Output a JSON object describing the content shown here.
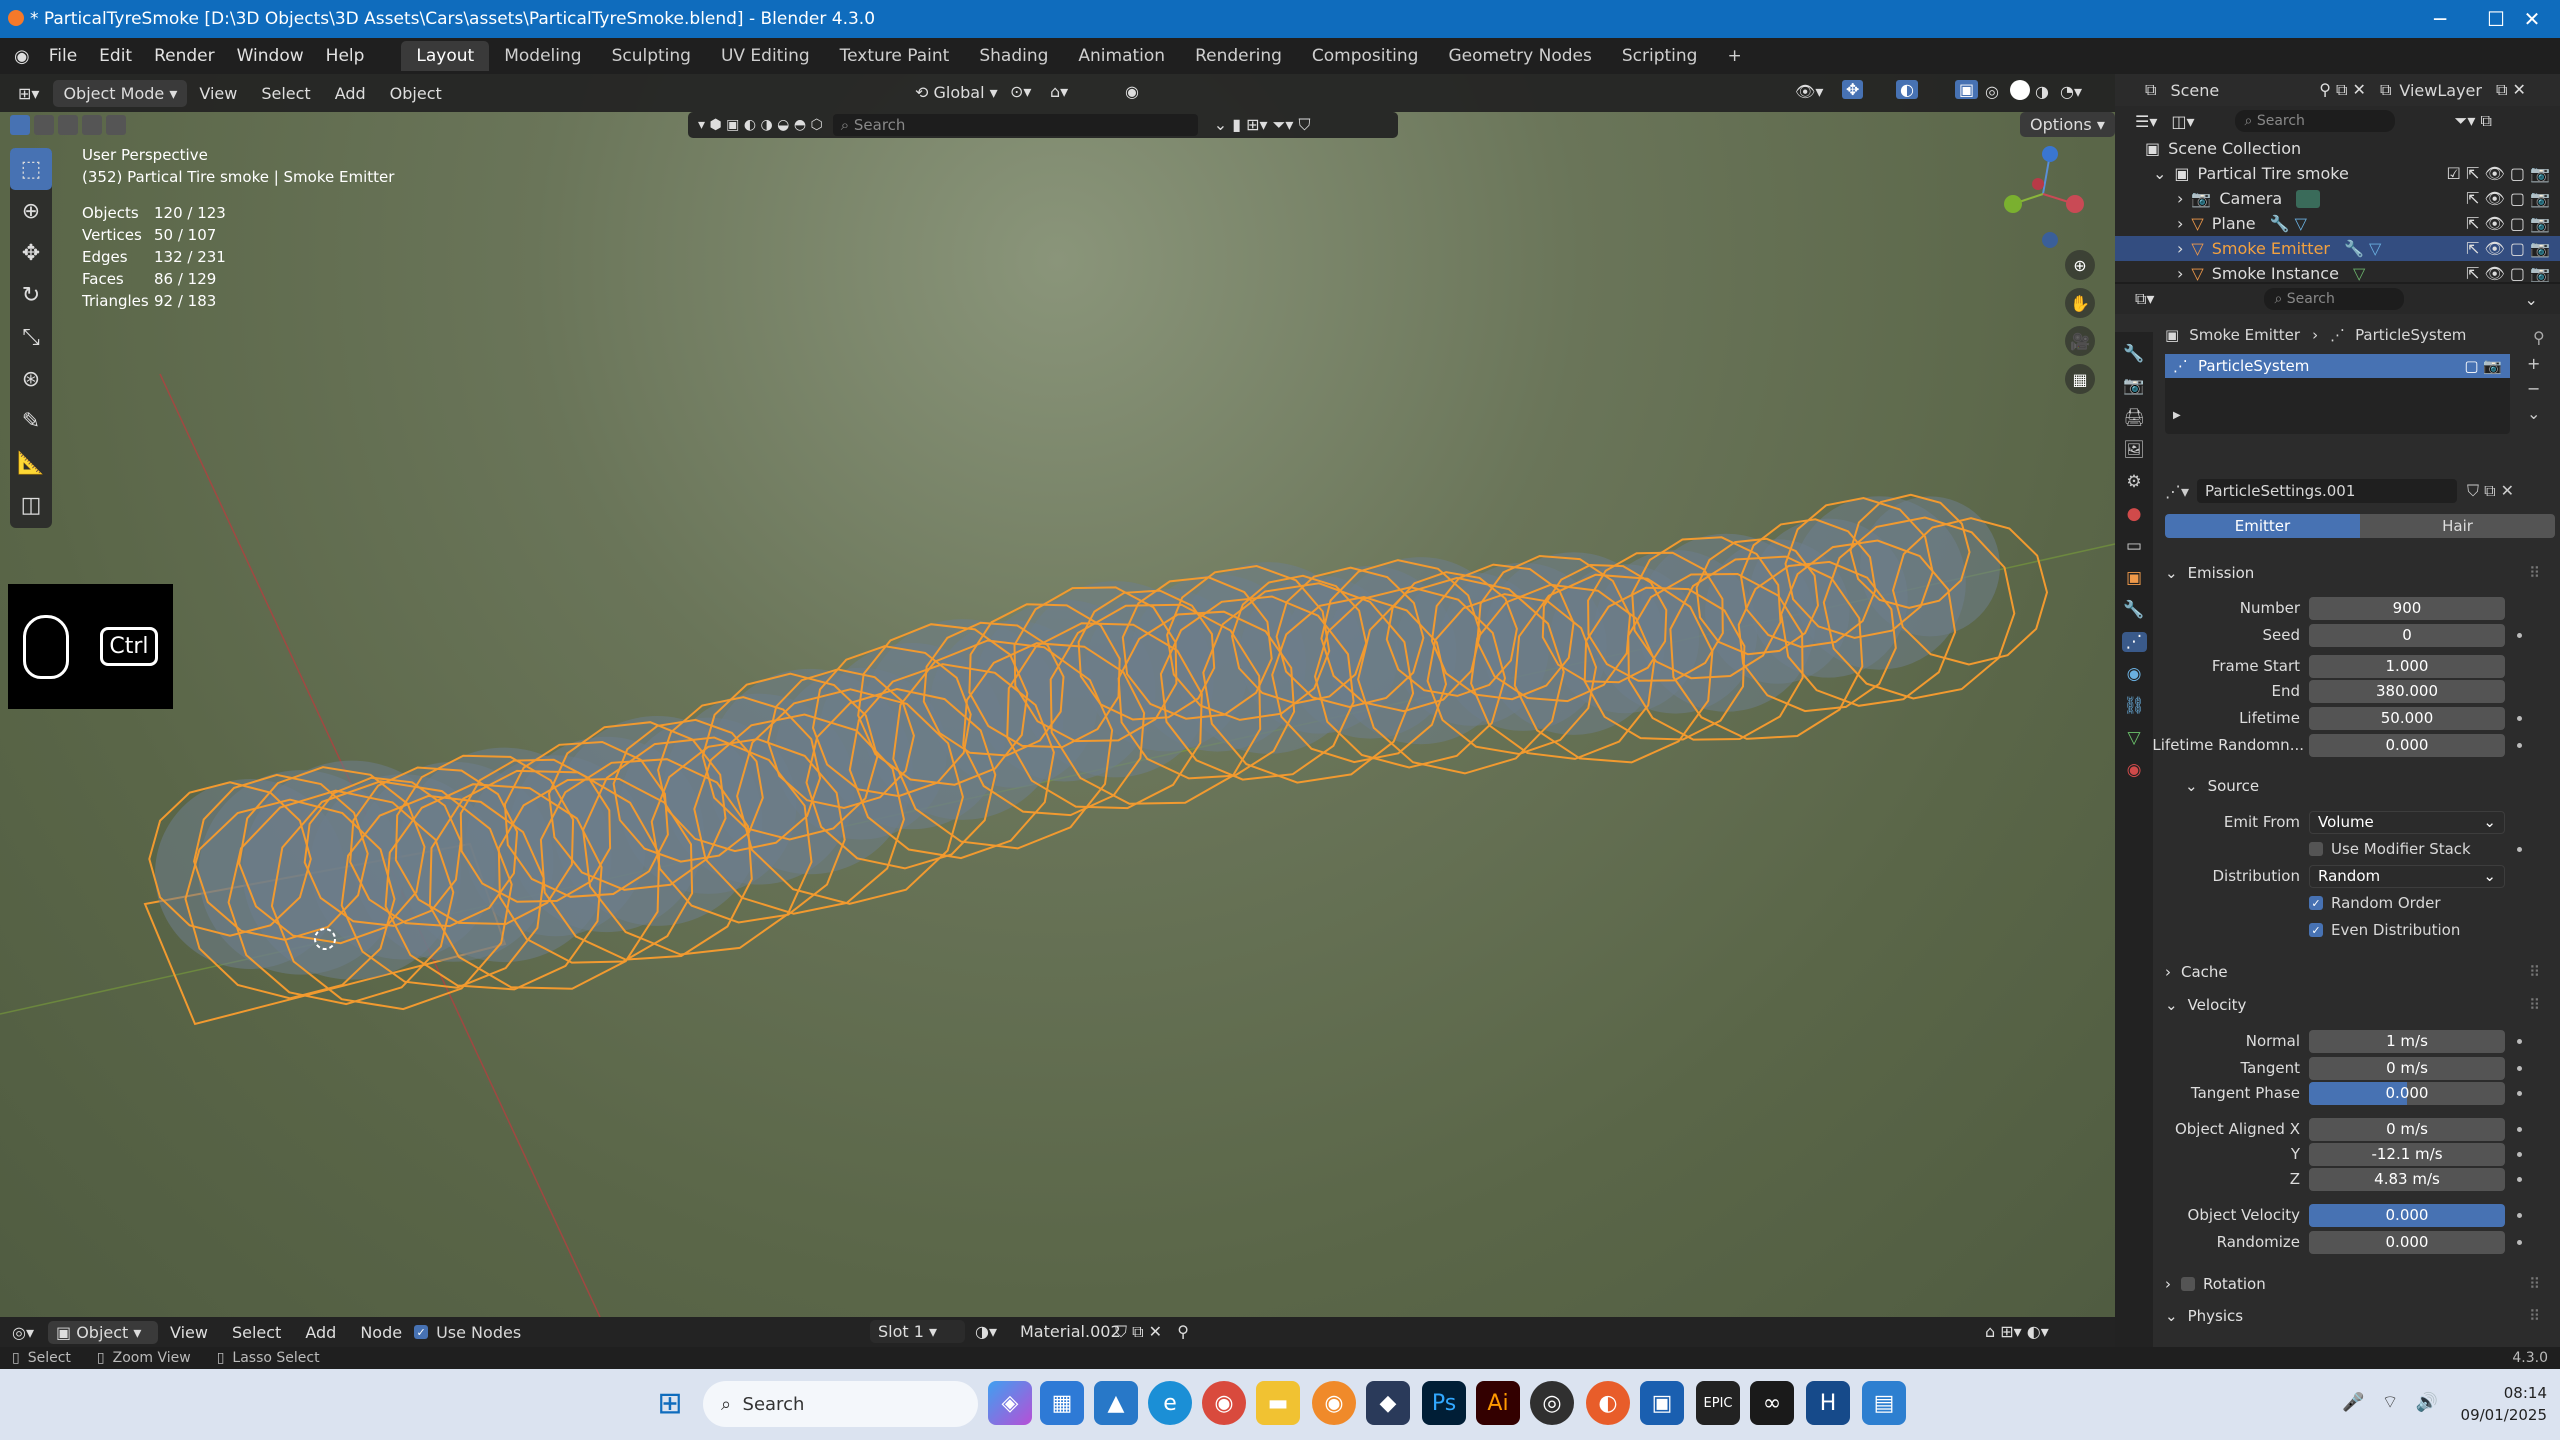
{
  "window": {
    "title": "* ParticalTyreSmoke [D:\\3D Objects\\3D Assets\\Cars\\assets\\ParticalTyreSmoke.blend] - Blender 4.3.0"
  },
  "menu": [
    "File",
    "Edit",
    "Render",
    "Window",
    "Help"
  ],
  "workspaces": [
    "Layout",
    "Modeling",
    "Sculpting",
    "UV Editing",
    "Texture Paint",
    "Shading",
    "Animation",
    "Rendering",
    "Compositing",
    "Geometry Nodes",
    "Scripting"
  ],
  "viewport_header": {
    "mode": "Object Mode",
    "view": "View",
    "select": "Select",
    "add": "Add",
    "object": "Object",
    "transform": "Global",
    "search_placeholder": "Search",
    "options": "Options"
  },
  "overlay": {
    "perspective": "User Perspective",
    "context": "(352) Partical Tire smoke | Smoke Emitter"
  },
  "stats": [
    {
      "label": "Objects",
      "value": "120 / 123"
    },
    {
      "label": "Vertices",
      "value": "50 / 107"
    },
    {
      "label": "Edges",
      "value": "132 / 231"
    },
    {
      "label": "Faces",
      "value": "86 / 129"
    },
    {
      "label": "Triangles",
      "value": "92 / 183"
    }
  ],
  "keyhint": {
    "key": "Ctrl"
  },
  "scene": {
    "name": "Scene",
    "viewlayer": "ViewLayer",
    "search_placeholder": "Search"
  },
  "outliner": {
    "root": "Scene Collection",
    "collection": "Partical Tire smoke",
    "items": [
      "Camera",
      "Plane",
      "Smoke Emitter",
      "Smoke Instance"
    ]
  },
  "properties": {
    "search_placeholder": "Search",
    "breadcrumb_object": "Smoke Emitter",
    "breadcrumb_system": "ParticleSystem",
    "slot": "ParticleSystem",
    "settings": "ParticleSettings.001",
    "tabs": [
      "Emitter",
      "Hair"
    ],
    "emission_title": "Emission",
    "emission": [
      {
        "label": "Number",
        "value": "900"
      },
      {
        "label": "Seed",
        "value": "0"
      },
      {
        "label": "Frame Start",
        "value": "1.000"
      },
      {
        "label": "End",
        "value": "380.000"
      },
      {
        "label": "Lifetime",
        "value": "50.000"
      },
      {
        "label": "Lifetime Randomn...",
        "value": "0.000"
      }
    ],
    "source_title": "Source",
    "emit_from_label": "Emit From",
    "emit_from": "Volume",
    "use_modifier_stack": "Use Modifier Stack",
    "distribution_label": "Distribution",
    "distribution": "Random",
    "random_order": "Random Order",
    "even_distribution": "Even Distribution",
    "cache_title": "Cache",
    "velocity_title": "Velocity",
    "velocity": [
      {
        "label": "Normal",
        "value": "1 m/s"
      },
      {
        "label": "Tangent",
        "value": "0 m/s"
      },
      {
        "label": "Tangent Phase",
        "value": "0.000"
      },
      {
        "label": "Object Aligned X",
        "value": "0 m/s"
      },
      {
        "label": "Y",
        "value": "-12.1 m/s"
      },
      {
        "label": "Z",
        "value": "4.83 m/s"
      },
      {
        "label": "Object Velocity",
        "value": "0.000"
      },
      {
        "label": "Randomize",
        "value": "0.000"
      }
    ],
    "rotation_title": "Rotation",
    "physics_title": "Physics"
  },
  "node_header": {
    "type": "Object",
    "view": "View",
    "select": "Select",
    "add": "Add",
    "node": "Node",
    "use_nodes": "Use Nodes",
    "slot": "Slot 1",
    "material": "Material.002"
  },
  "statusbar": {
    "select": "Select",
    "zoom": "Zoom View",
    "lasso": "Lasso Select",
    "version": "4.3.0"
  },
  "taskbar": {
    "search": "Search",
    "time": "08:14",
    "date": "09/01/2025"
  }
}
